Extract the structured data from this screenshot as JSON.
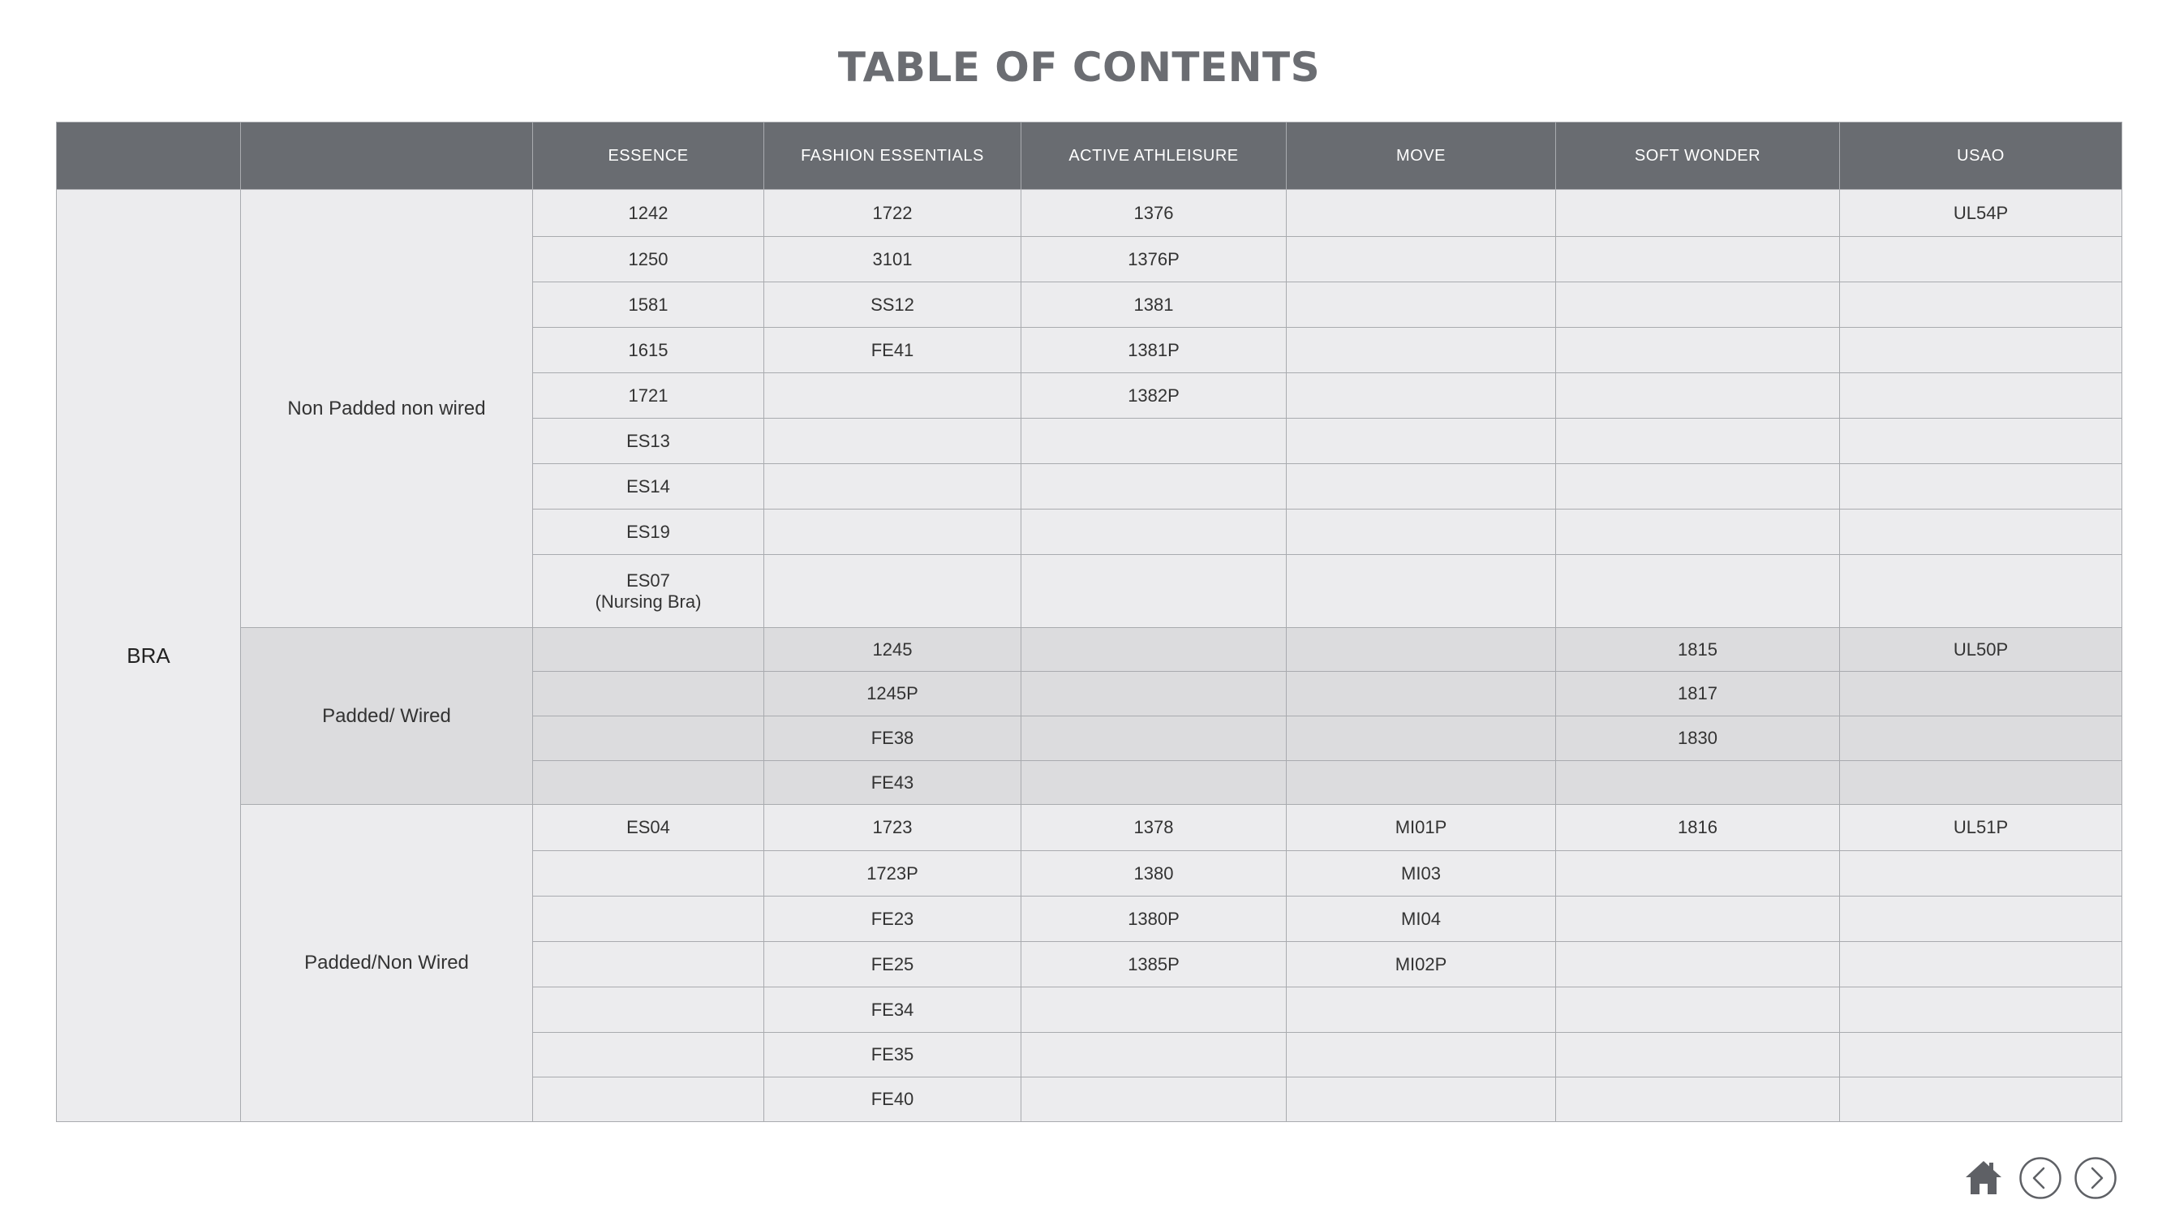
{
  "title": "TABLE OF CONTENTS",
  "columns": [
    "",
    "",
    "ESSENCE",
    "FASHION ESSENTIALS",
    "ACTIVE ATHLEISURE",
    "MOVE",
    "SOFT WONDER",
    "USAO"
  ],
  "category": "BRA",
  "groups": [
    {
      "name": "Non Padded non wired",
      "shade": "light",
      "rows": [
        [
          "1242",
          "1722",
          "1376",
          "",
          "",
          "UL54P"
        ],
        [
          "1250",
          "3101",
          "1376P",
          "",
          "",
          ""
        ],
        [
          "1581",
          "SS12",
          "1381",
          "",
          "",
          ""
        ],
        [
          "1615",
          "FE41",
          "1381P",
          "",
          "",
          ""
        ],
        [
          "1721",
          "",
          "1382P",
          "",
          "",
          ""
        ],
        [
          "ES13",
          "",
          "",
          "",
          "",
          ""
        ],
        [
          "ES14",
          "",
          "",
          "",
          "",
          ""
        ],
        [
          "ES19",
          "",
          "",
          "",
          "",
          ""
        ],
        [
          "ES07\n(Nursing Bra)",
          "",
          "",
          "",
          "",
          ""
        ]
      ]
    },
    {
      "name": "Padded/ Wired",
      "shade": "dark",
      "rows": [
        [
          "",
          "1245",
          "",
          "",
          "1815",
          "UL50P"
        ],
        [
          "",
          "1245P",
          "",
          "",
          "1817",
          ""
        ],
        [
          "",
          "FE38",
          "",
          "",
          "1830",
          ""
        ],
        [
          "",
          "FE43",
          "",
          "",
          "",
          ""
        ]
      ]
    },
    {
      "name": "Padded/Non Wired",
      "shade": "light",
      "rows": [
        [
          "ES04",
          "1723",
          "1378",
          "MI01P",
          "1816",
          "UL51P"
        ],
        [
          "",
          "1723P",
          "1380",
          "MI03",
          "",
          ""
        ],
        [
          "",
          "FE23",
          "1380P",
          "MI04",
          "",
          ""
        ],
        [
          "",
          "FE25",
          "1385P",
          "MI02P",
          "",
          ""
        ],
        [
          "",
          "FE34",
          "",
          "",
          "",
          ""
        ],
        [
          "",
          "FE35",
          "",
          "",
          "",
          ""
        ],
        [
          "",
          "FE40",
          "",
          "",
          "",
          ""
        ]
      ]
    }
  ],
  "nav": {
    "home_icon": "home-icon",
    "prev_icon": "chevron-left-circle-icon",
    "next_icon": "chevron-right-circle-icon"
  },
  "colors": {
    "header_bg": "#696c71",
    "title": "#6b6d72",
    "cell_light": "#ececee",
    "cell_dark": "#dcdcde",
    "border": "#a9abaf"
  }
}
